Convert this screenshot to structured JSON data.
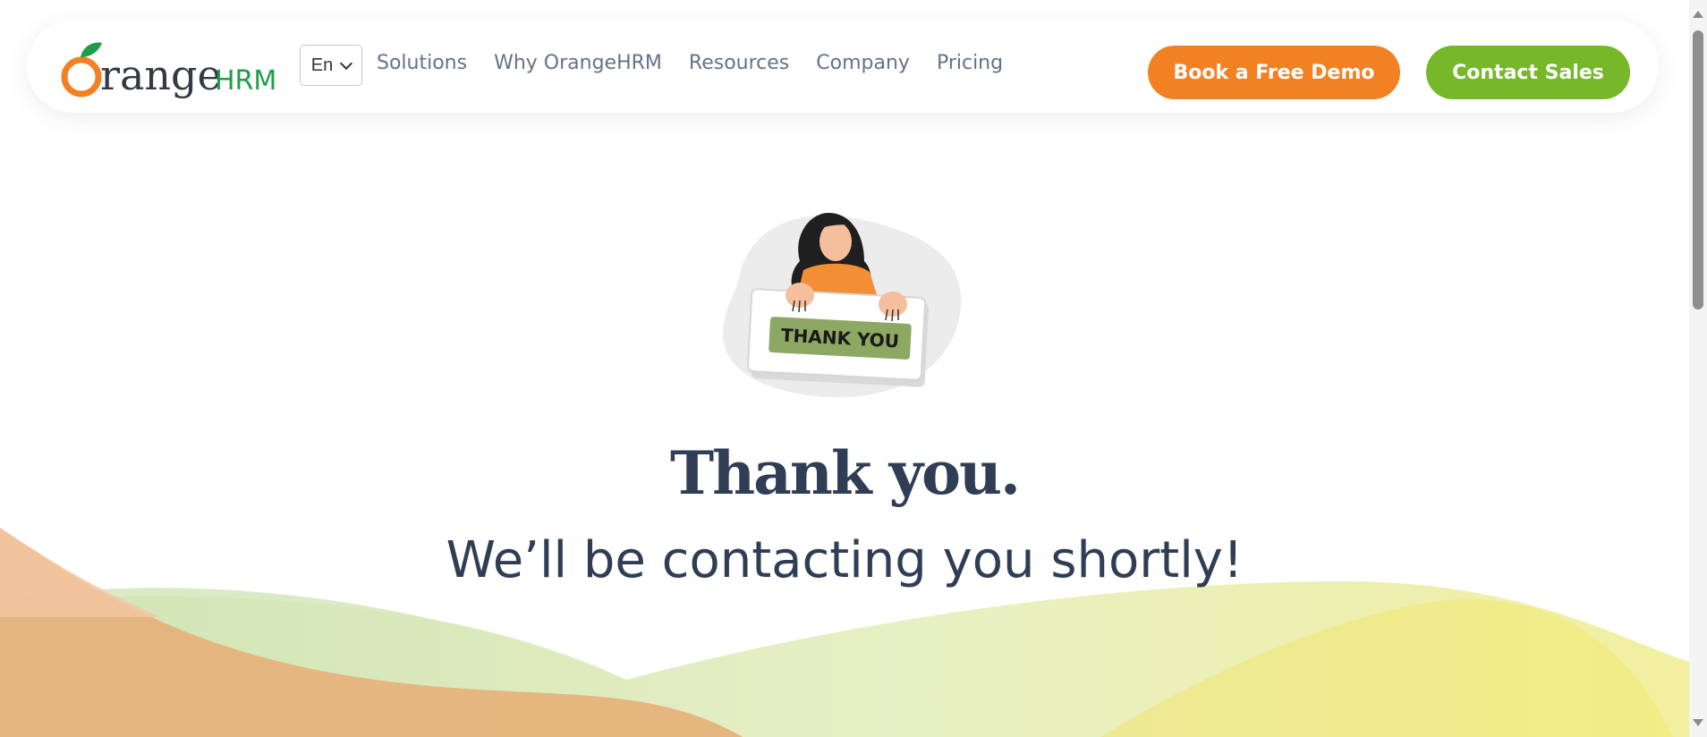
{
  "brand": {
    "logo_text_main": "Orange",
    "logo_text_suffix": "HRM",
    "colors": {
      "orange": "#f28123",
      "green": "#76b82a",
      "logo_green": "#1e9e48",
      "text_dark": "#2f3e55",
      "nav_text": "#64728c"
    }
  },
  "header": {
    "language": {
      "selected": "En"
    },
    "nav_items": [
      {
        "label": "Solutions"
      },
      {
        "label": "Why OrangeHRM"
      },
      {
        "label": "Resources"
      },
      {
        "label": "Company"
      },
      {
        "label": "Pricing"
      }
    ],
    "demo_button": "Book a Free Demo",
    "sales_button": "Contact Sales"
  },
  "main": {
    "illustration_sign": "THANK YOU",
    "title": "Thank you.",
    "subtitle": "We’ll be contacting you shortly!"
  }
}
